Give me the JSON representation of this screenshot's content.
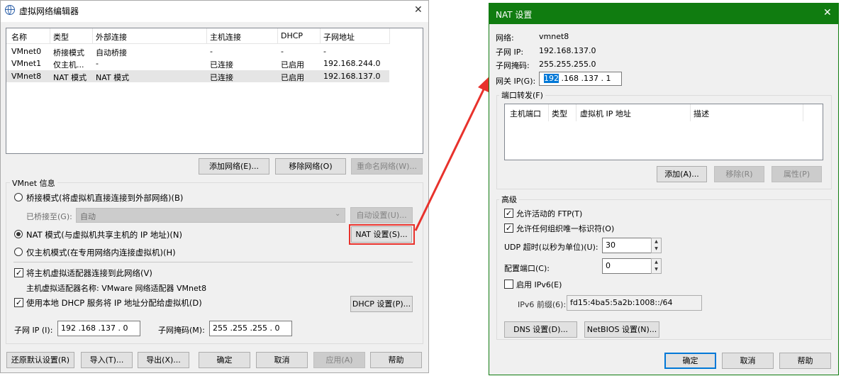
{
  "left": {
    "title": "虚拟网络编辑器",
    "close_glyph": "✕",
    "table": {
      "headers": [
        "名称",
        "类型",
        "外部连接",
        "主机连接",
        "DHCP",
        "子网地址"
      ],
      "rows": [
        [
          "VMnet0",
          "桥接模式",
          "自动桥接",
          "-",
          "-",
          "-"
        ],
        [
          "VMnet1",
          "仅主机...",
          "-",
          "已连接",
          "已启用",
          "192.168.244.0"
        ],
        [
          "VMnet8",
          "NAT 模式",
          "NAT 模式",
          "已连接",
          "已启用",
          "192.168.137.0"
        ]
      ]
    },
    "buttons": {
      "add": "添加网络(E)...",
      "remove": "移除网络(O)",
      "rename": "重命名网络(W)..."
    },
    "vmnet_info": {
      "title": "VMnet 信息",
      "bridge_label": "桥接模式(将虚拟机直接连接到外部网络)(B)",
      "bridged_to_label": "已桥接至(G):",
      "bridged_to_value": "自动",
      "auto_setup": "自动设置(U)...",
      "nat_label": "NAT 模式(与虚拟机共享主机的 IP 地址)(N)",
      "nat_settings": "NAT 设置(S)...",
      "hostonly_label": "仅主机模式(在专用网络内连接虚拟机)(H)",
      "connect_adapter_label": "将主机虚拟适配器连接到此网络(V)",
      "adapter_name_label": "主机虚拟适配器名称: VMware 网络适配器 VMnet8",
      "dhcp_label": "使用本地 DHCP 服务将 IP 地址分配给虚拟机(D)",
      "dhcp_settings": "DHCP 设置(P)...",
      "subnet_ip_label": "子网 IP (I):",
      "subnet_ip_value": "192 .168 .137 .  0",
      "subnet_mask_label": "子网掩码(M):",
      "subnet_mask_value": "255 .255 .255 .  0"
    },
    "footer": {
      "restore": "还原默认设置(R)",
      "import": "导入(T)...",
      "export": "导出(X)...",
      "ok": "确定",
      "cancel": "取消",
      "apply": "应用(A)",
      "help": "帮助"
    }
  },
  "right": {
    "title": "NAT 设置",
    "close_glyph": "✕",
    "network_label": "网络:",
    "network_value": "vmnet8",
    "subnet_ip_label": "子网 IP:",
    "subnet_ip_value": "192.168.137.0",
    "subnet_mask_label": "子网掩码:",
    "subnet_mask_value": "255.255.255.0",
    "gateway_label": "网关 IP(G):",
    "gateway_first": "192",
    "gateway_rest": " .168 .137 .  1",
    "port_forwarding": {
      "title": "端口转发(F)",
      "headers": [
        "主机端口",
        "类型",
        "虚拟机 IP 地址",
        "描述"
      ],
      "add": "添加(A)...",
      "remove": "移除(R)",
      "properties": "属性(P)"
    },
    "advanced": {
      "title": "高级",
      "ftp_label": "允许活动的 FTP(T)",
      "oui_label": "允许任何组织唯一标识符(O)",
      "udp_label": "UDP 超时(以秒为单位)(U):",
      "udp_value": "30",
      "config_port_label": "配置端口(C):",
      "config_port_value": "0",
      "ipv6_label": "启用 IPv6(E)",
      "ipv6_prefix_label": "IPv6 前缀(6):",
      "ipv6_prefix_value": "fd15:4ba5:5a2b:1008::/64",
      "dns_button": "DNS 设置(D)...",
      "netbios_button": "NetBIOS 设置(N)..."
    },
    "footer": {
      "ok": "确定",
      "cancel": "取消",
      "help": "帮助"
    }
  },
  "colors": {
    "nat_title_bg": "#107c10",
    "highlight_red": "#e8322c",
    "selection_blue": "#0078d7"
  }
}
